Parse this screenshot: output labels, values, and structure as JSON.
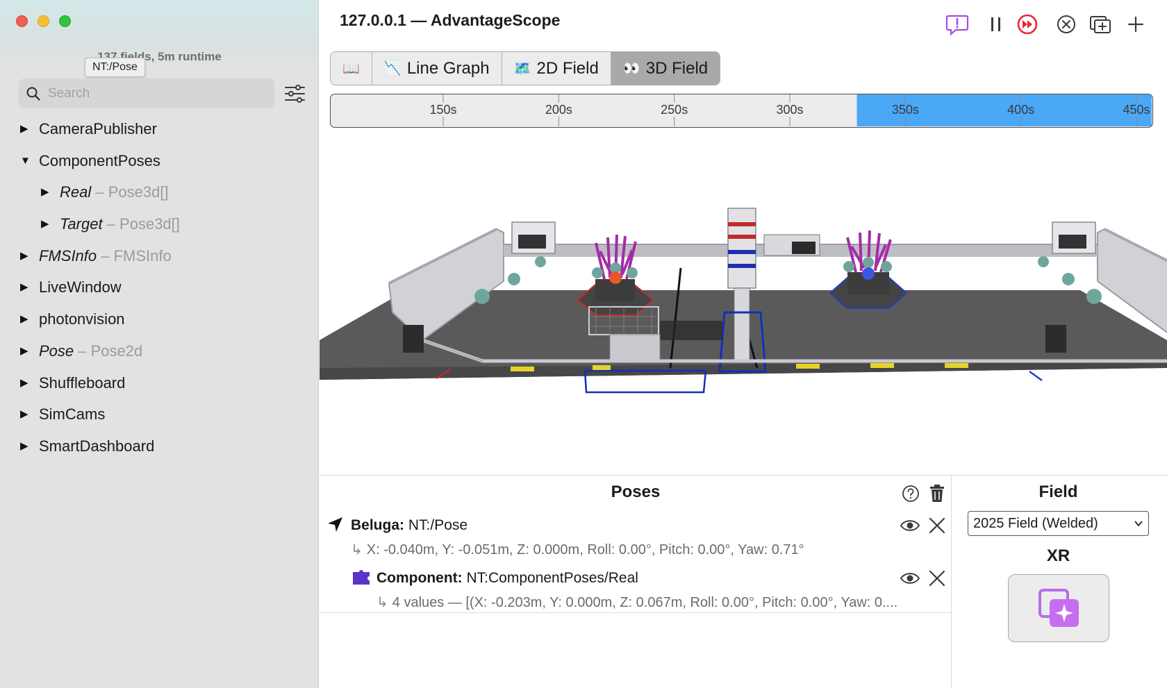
{
  "window": {
    "title": "127.0.0.1 — AdvantageScope"
  },
  "sidebar": {
    "status": "137 fields, 5m runtime",
    "tooltip": "NT:/Pose",
    "search_placeholder": "Search",
    "tree": [
      {
        "label": "CameraPublisher",
        "type": "",
        "italic": false,
        "expanded": false,
        "indent": 0
      },
      {
        "label": "ComponentPoses",
        "type": "",
        "italic": false,
        "expanded": true,
        "indent": 0
      },
      {
        "label": "Real",
        "type": "– Pose3d[]",
        "italic": true,
        "expanded": false,
        "indent": 1
      },
      {
        "label": "Target",
        "type": "– Pose3d[]",
        "italic": true,
        "expanded": false,
        "indent": 1
      },
      {
        "label": "FMSInfo",
        "type": "– FMSInfo",
        "italic": true,
        "expanded": false,
        "indent": 0
      },
      {
        "label": "LiveWindow",
        "type": "",
        "italic": false,
        "expanded": false,
        "indent": 0
      },
      {
        "label": "photonvision",
        "type": "",
        "italic": false,
        "expanded": false,
        "indent": 0
      },
      {
        "label": "Pose",
        "type": "– Pose2d",
        "italic": true,
        "expanded": false,
        "indent": 0
      },
      {
        "label": "Shuffleboard",
        "type": "",
        "italic": false,
        "expanded": false,
        "indent": 0
      },
      {
        "label": "SimCams",
        "type": "",
        "italic": false,
        "expanded": false,
        "indent": 0
      },
      {
        "label": "SmartDashboard",
        "type": "",
        "italic": false,
        "expanded": false,
        "indent": 0
      }
    ]
  },
  "toolbar": {
    "icons": [
      "feedback-icon",
      "pause-icon",
      "live-icon",
      "close-tab-icon",
      "new-window-icon",
      "add-tab-icon"
    ]
  },
  "tabs": [
    {
      "label": "",
      "icon": "📖",
      "active": false
    },
    {
      "label": "Line Graph",
      "icon": "📉",
      "active": false
    },
    {
      "label": "2D Field",
      "icon": "🗺️",
      "active": false
    },
    {
      "label": "3D Field",
      "icon": "👀",
      "active": true
    }
  ],
  "timeline": {
    "ticks": [
      "150s",
      "200s",
      "250s",
      "300s",
      "350s",
      "400s",
      "450s"
    ],
    "tick_values": [
      150,
      200,
      250,
      300,
      350,
      400,
      450
    ],
    "range": [
      101.3,
      456.6
    ],
    "selection_start": 329,
    "selection_color": "#4aa8f7"
  },
  "poses": {
    "title": "Poses",
    "items": [
      {
        "name": "Beluga:",
        "key": "NT:/Pose",
        "detail": "X: -0.040m, Y: -0.051m, Z: 0.000m, Roll: 0.00°, Pitch: 0.00°, Yaw: 0.71°"
      },
      {
        "name": "Component:",
        "key": "NT:ComponentPoses/Real",
        "detail": "4 values — [(X: -0.203m, Y: 0.000m, Z: 0.067m, Roll: 0.00°, Pitch: 0.00°, Yaw: 0...."
      }
    ]
  },
  "field_panel": {
    "title": "Field",
    "selected": "2025 Field (Welded)",
    "xr_title": "XR"
  },
  "colors": {
    "accent": "#4aa8f7",
    "live": "#e8273a",
    "feedback": "#a24fe0"
  }
}
